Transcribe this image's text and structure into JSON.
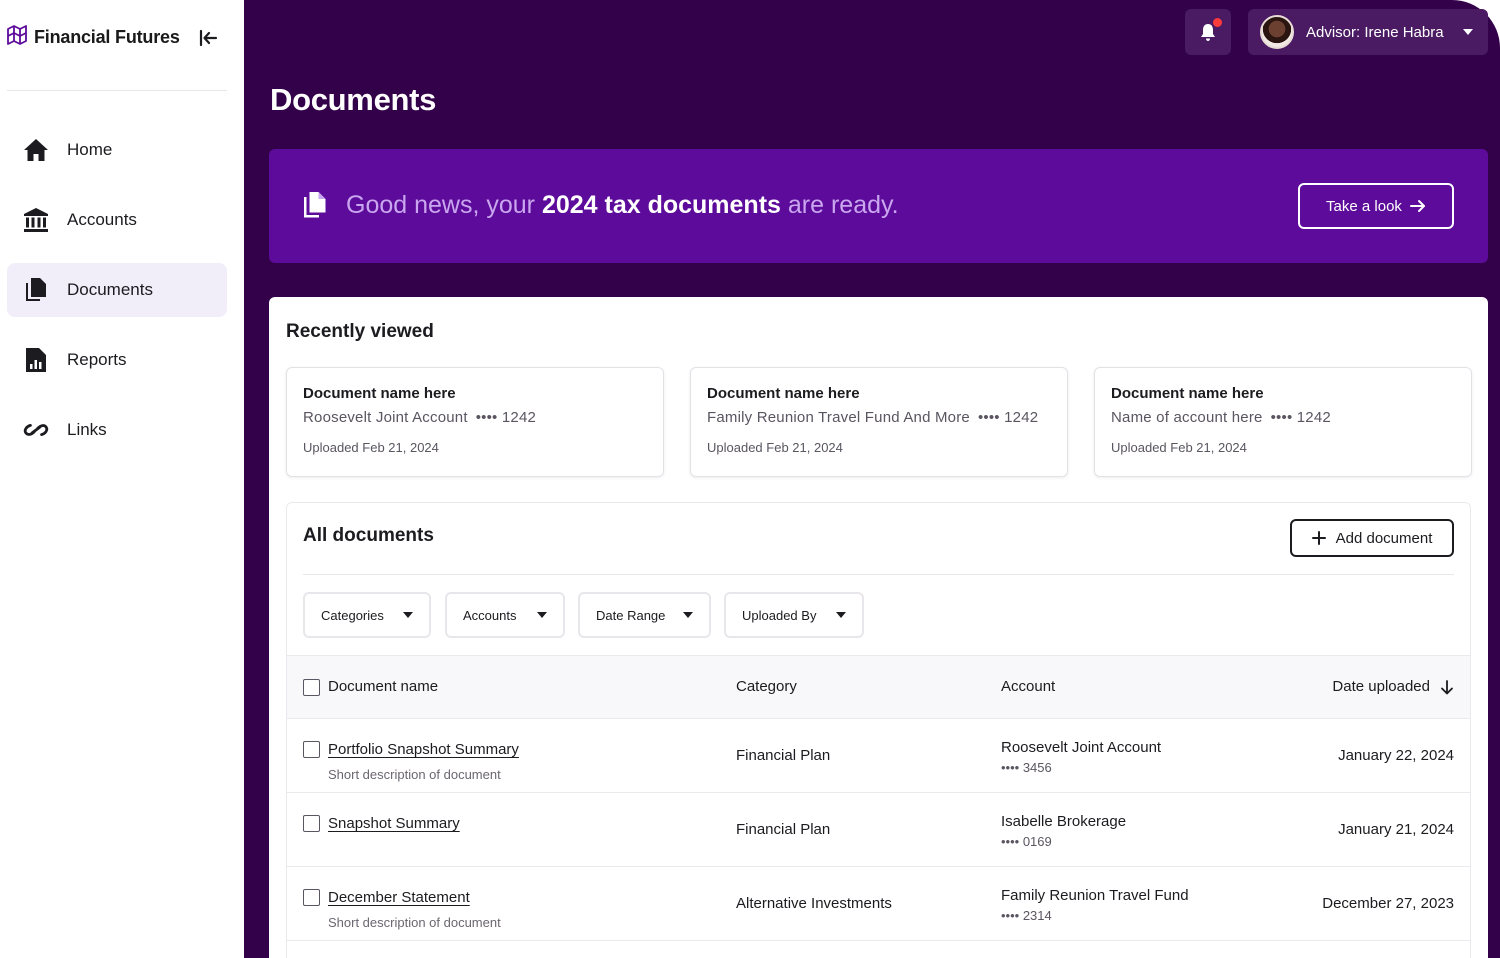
{
  "sidebar": {
    "brand": "Financial Futures",
    "items": [
      {
        "label": "Home",
        "icon": "home-icon"
      },
      {
        "label": "Accounts",
        "icon": "bank-icon"
      },
      {
        "label": "Documents",
        "icon": "documents-icon",
        "active": true
      },
      {
        "label": "Reports",
        "icon": "report-icon"
      },
      {
        "label": "Links",
        "icon": "link-icon"
      }
    ]
  },
  "header": {
    "advisor_label": "Advisor: Irene Habra",
    "page_title": "Documents"
  },
  "banner": {
    "text_pre": "Good news, your ",
    "text_bold": "2024 tax documents",
    "text_post": " are ready.",
    "button_label": "Take a look"
  },
  "recent": {
    "title": "Recently viewed",
    "cards": [
      {
        "name": "Document name here",
        "account": "Roosevelt Joint Account",
        "mask": "•••• 1242",
        "uploaded": "Uploaded Feb 21, 2024"
      },
      {
        "name": "Document name here",
        "account": "Family Reunion Travel Fund And More",
        "mask": "•••• 1242",
        "uploaded": "Uploaded Feb 21, 2024"
      },
      {
        "name": "Document name here",
        "account": "Name of account here",
        "mask": "•••• 1242",
        "uploaded": "Uploaded Feb 21, 2024"
      }
    ]
  },
  "all_documents": {
    "title": "All documents",
    "add_button": "Add document",
    "filters": [
      "Categories",
      "Accounts",
      "Date Range",
      "Uploaded By"
    ],
    "columns": {
      "name": "Document name",
      "category": "Category",
      "account": "Account",
      "date": "Date uploaded"
    },
    "rows": [
      {
        "name": "Portfolio Snapshot Summary",
        "description": "Short description of document",
        "category": "Financial Plan",
        "account": "Roosevelt Joint Account",
        "mask": "•••• 3456",
        "date": "January 22, 2024"
      },
      {
        "name": "Snapshot Summary",
        "description": "",
        "category": "Financial Plan",
        "account": "Isabelle Brokerage",
        "mask": "•••• 0169",
        "date": "January 21, 2024"
      },
      {
        "name": "December Statement",
        "description": "Short description of document",
        "category": "Alternative Investments",
        "account": "Family Reunion Travel Fund",
        "mask": "•••• 2314",
        "date": "December 27, 2023"
      }
    ]
  },
  "colors": {
    "main_bg": "#33004a",
    "banner_bg": "#5d0b9a",
    "active_nav_bg": "#f1eefa",
    "notification_dot": "#ff3b3b"
  }
}
